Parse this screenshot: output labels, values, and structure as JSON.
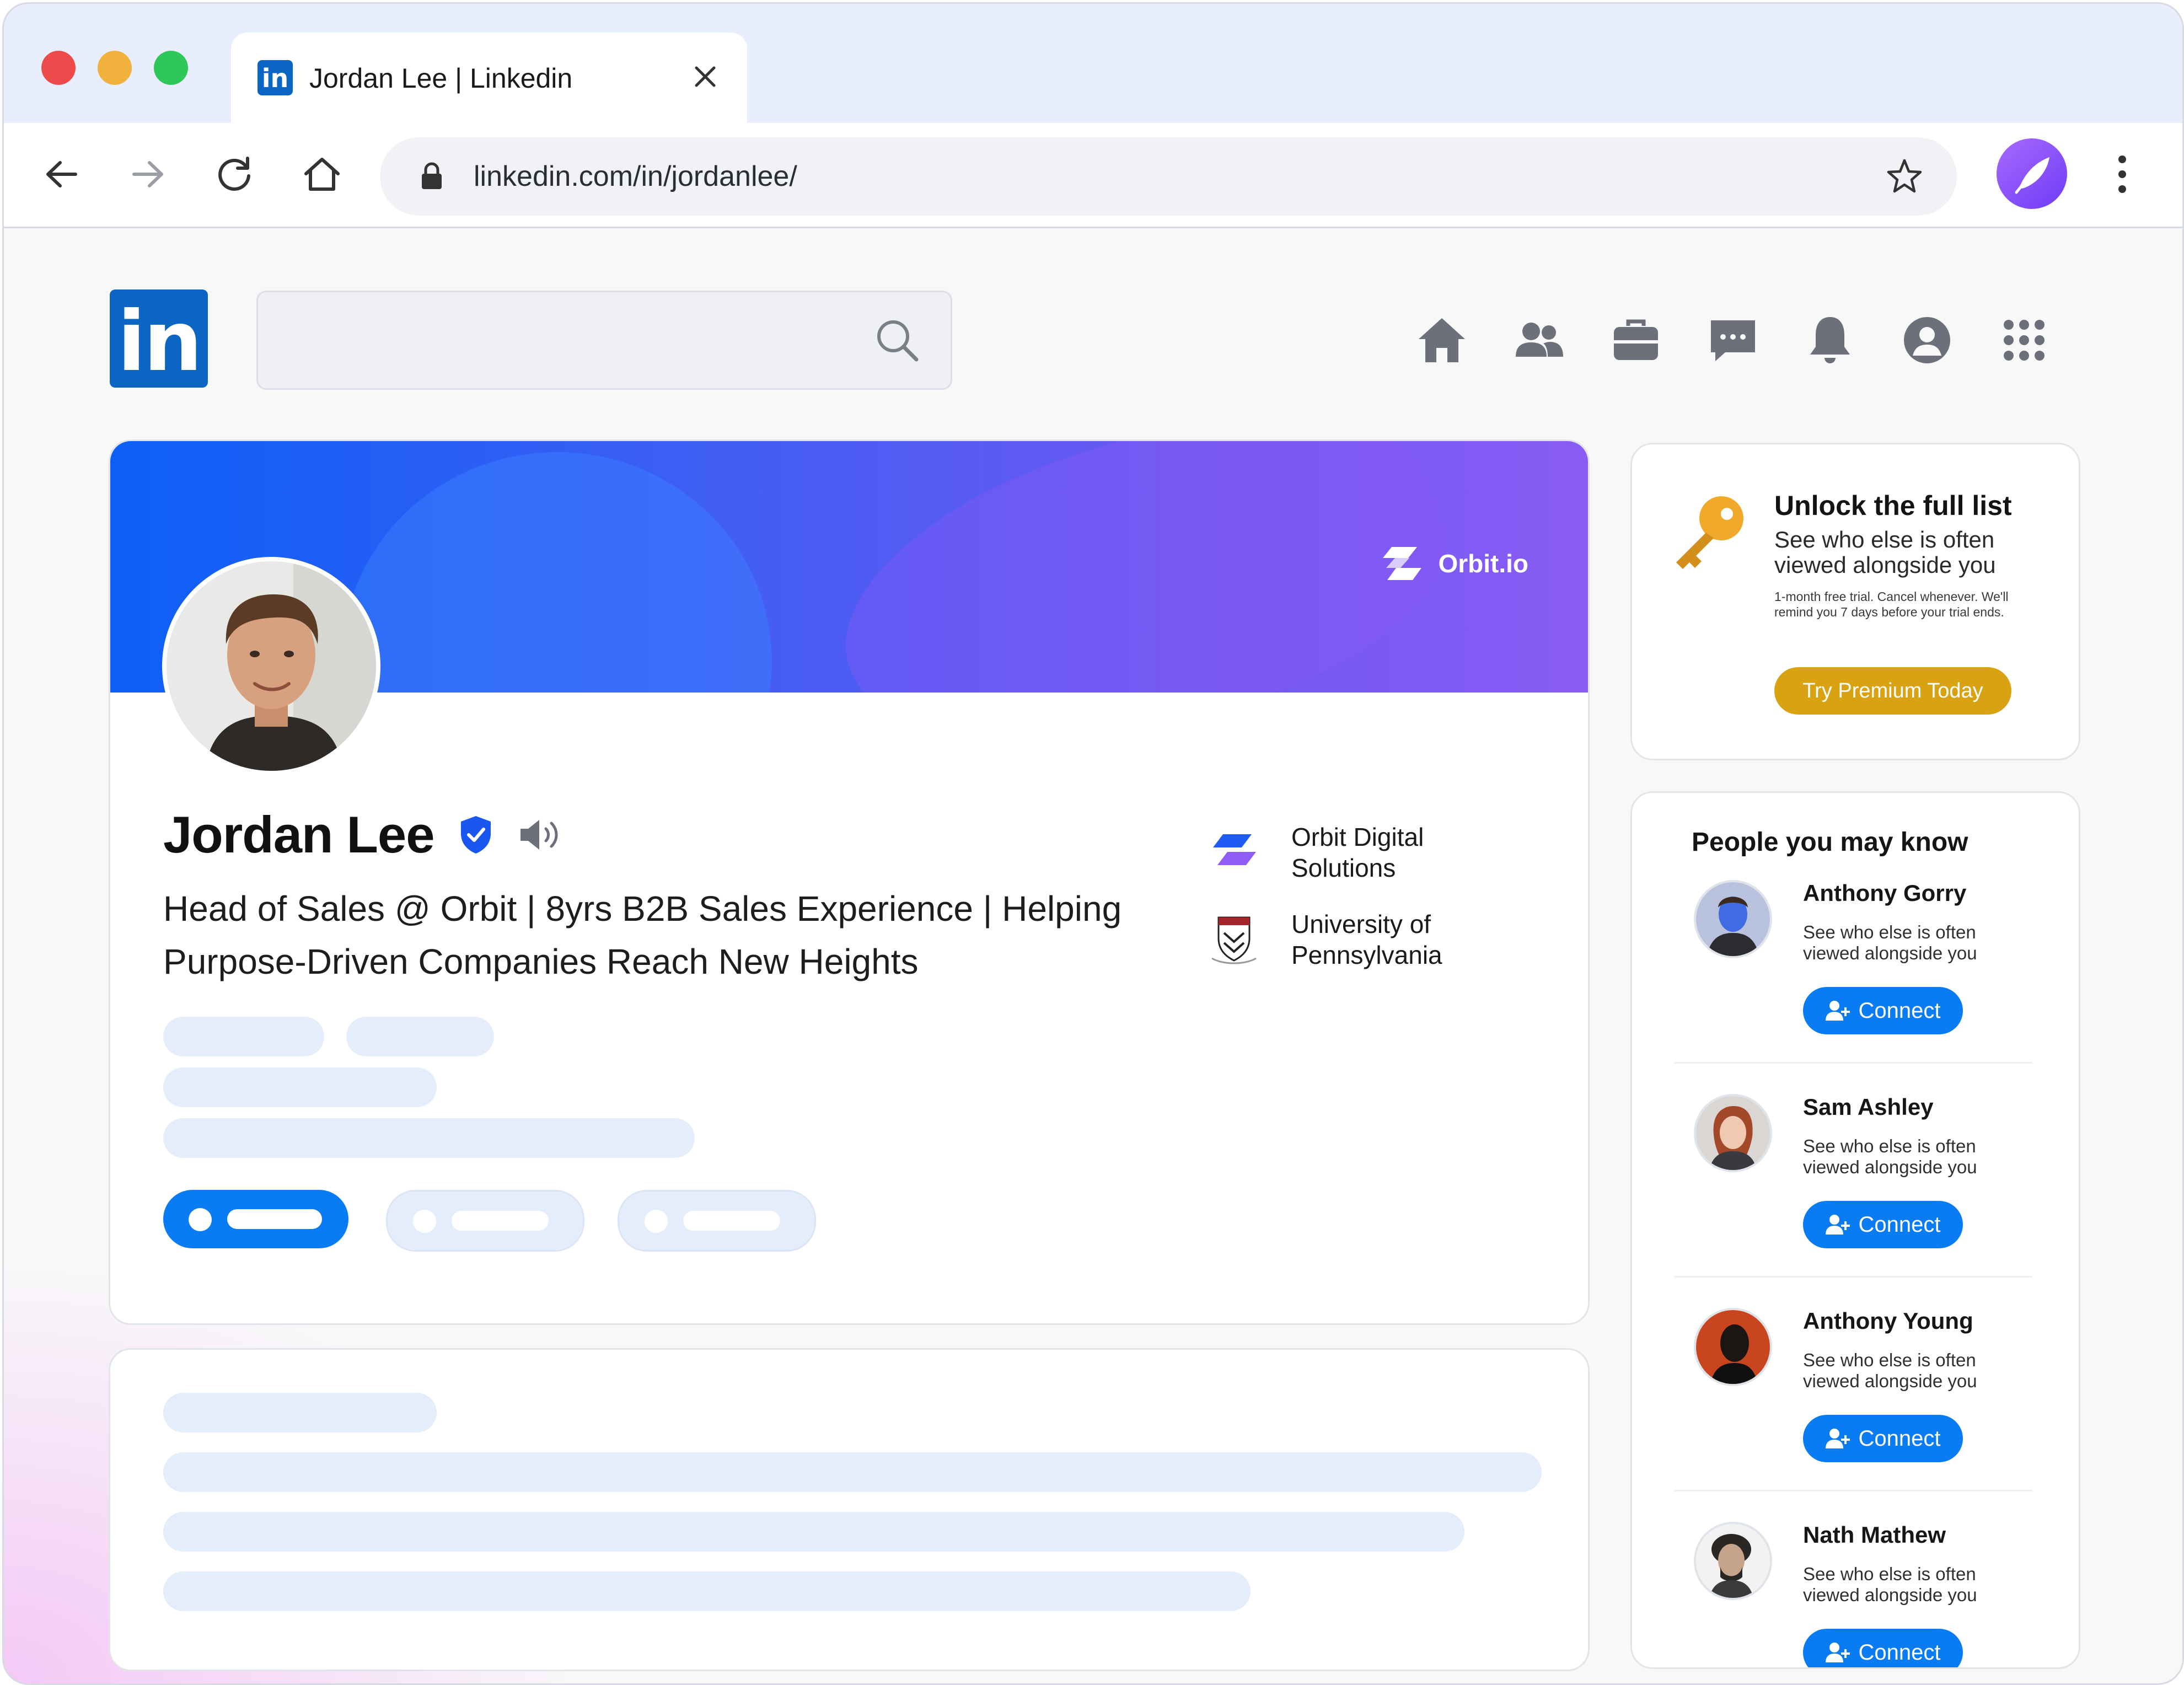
{
  "browser": {
    "tab_title": "Jordan Lee  | Linkedin",
    "tab_logo": "in",
    "url": "linkedin.com/in/jordanlee/"
  },
  "linkedin": {
    "logo_text": "in"
  },
  "profile": {
    "name": "Jordan Lee",
    "headline": "Head of Sales @ Orbit | 8yrs B2B Sales Experience | Helping Purpose-Driven Companies Reach New Heights",
    "banner_brand": "Orbit.io",
    "company": "Orbit Digital Solutions",
    "school": "University of Pennsylvania"
  },
  "premium": {
    "title": "Unlock the full list",
    "subtitle": "See who else is often viewed alongside you",
    "fine_print": "1-month free trial. Cancel whenever. We'll remind you 7 days before your trial ends.",
    "button": "Try Premium Today"
  },
  "people": {
    "title": "People you may know",
    "items": [
      {
        "name": "Anthony Gorry",
        "subtitle": "See who else is often viewed alongside you",
        "button": "Connect"
      },
      {
        "name": "Sam Ashley",
        "subtitle": "See who else is often viewed alongside you",
        "button": "Connect"
      },
      {
        "name": "Anthony Young",
        "subtitle": "See who else is often viewed alongside you",
        "button": "Connect"
      },
      {
        "name": "Nath Mathew",
        "subtitle": "See who else is often viewed alongside you",
        "button": "Connect"
      }
    ]
  },
  "colors": {
    "linkedin_blue": "#0a66c2",
    "connect_blue": "#0a7cf3",
    "premium_gold": "#d9a213",
    "verified_blue": "#1a56f0"
  },
  "icons": [
    "back-icon",
    "forward-icon",
    "reload-icon",
    "home-icon",
    "lock-icon",
    "star-icon",
    "extension-icon",
    "menu-icon",
    "search-icon",
    "nav-home-icon",
    "nav-network-icon",
    "nav-jobs-icon",
    "nav-messaging-icon",
    "nav-notifications-icon",
    "nav-me-icon",
    "nav-apps-icon",
    "verified-icon",
    "audio-icon",
    "key-icon",
    "add-person-icon"
  ]
}
